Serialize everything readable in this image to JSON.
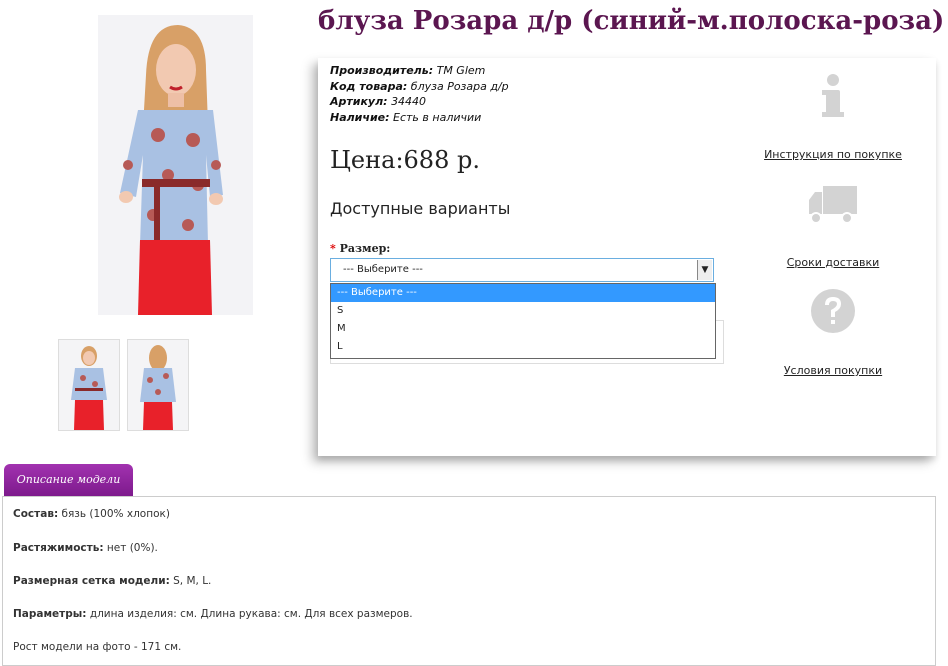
{
  "product": {
    "title": "блуза Розара д/р (синий-м.полоска-роза)"
  },
  "meta": [
    {
      "label": "Производитель:",
      "value": "TM Glem"
    },
    {
      "label": "Код товара:",
      "value": "блуза Розара д/р"
    },
    {
      "label": "Артикул:",
      "value": "34440"
    },
    {
      "label": "Наличие:",
      "value": "Есть в наличии"
    }
  ],
  "price": "Цена:688 р.",
  "variants_title": "Доступные варианты",
  "size": {
    "required_mark": "*",
    "label": "Размер:",
    "selected": "--- Выберите ---",
    "options": [
      "--- Выберите ---",
      "S",
      "M",
      "L"
    ]
  },
  "side_links": {
    "instructions": "Инструкция по покупке",
    "delivery": "Сроки доставки",
    "terms": "Условия покупки"
  },
  "tab_label": "Описание модели",
  "description": {
    "composition": {
      "k": "Состав:",
      "v": " бязь (100% хлопок)"
    },
    "stretch": {
      "k": "Растяжимость:",
      "v": " нет (0%)."
    },
    "sizes": {
      "k": "Размерная сетка модели:",
      "v": " S, M, L."
    },
    "params": {
      "k": "Параметры:",
      "v": " длина изделия: см. Длина рукава: см. Для всех размеров."
    },
    "height": "Рост модели на фото - 171 см."
  },
  "colors": {
    "title": "#5b1650",
    "tab": "#8e2399",
    "dropdown_selected": "#3399ff",
    "skirt": "#e8212a",
    "blouse": "#a9c1e3",
    "icon_gray": "#d3d3d3"
  }
}
